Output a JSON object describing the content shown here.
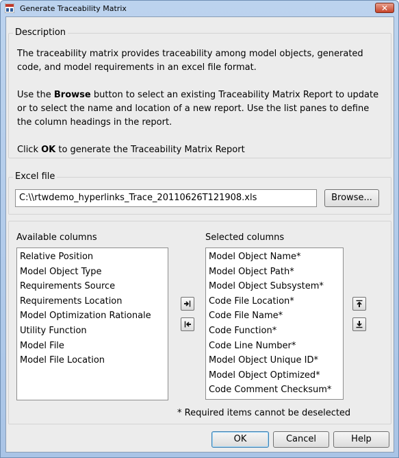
{
  "window": {
    "title": "Generate Traceability Matrix",
    "close_label": "✕"
  },
  "description": {
    "legend": "Description",
    "para1": "The traceability matrix provides traceability among model objects, generated code, and model requirements in an excel file format.",
    "para2_before": "Use the ",
    "para2_bold": "Browse",
    "para2_after": " button to select an existing Traceability Matrix Report to update or to select the name and location of a new report. Use the list panes to define the column headings in the report.",
    "para3_before": "Click ",
    "para3_bold": "OK",
    "para3_after": " to generate the Traceability Matrix Report"
  },
  "excel": {
    "legend": "Excel file",
    "path": "C:\\\\rtwdemo_hyperlinks_Trace_20110626T121908.xls",
    "browse_label": "Browse..."
  },
  "columns": {
    "available_label": "Available columns",
    "available": [
      "Relative Position",
      "Model Object Type",
      "Requirements Source",
      "Requirements Location",
      "Model Optimization Rationale",
      "Utility Function",
      "Model File",
      "Model File Location"
    ],
    "selected_label": "Selected columns",
    "selected": [
      "Model Object Name*",
      "Model Object Path*",
      "Model Object Subsystem*",
      "Code File Location*",
      "Code File Name*",
      "Code Function*",
      "Code Line Number*",
      "Model Object Unique ID*",
      "Model Object Optimized*",
      "Code Comment Checksum*"
    ],
    "required_note": "* Required items cannot be deselected"
  },
  "buttons": {
    "ok": "OK",
    "cancel": "Cancel",
    "help": "Help"
  },
  "icons": {
    "app": "matlab-app-icon",
    "add": "add-column-icon",
    "remove": "remove-column-icon",
    "up": "move-up-icon",
    "down": "move-down-icon"
  }
}
